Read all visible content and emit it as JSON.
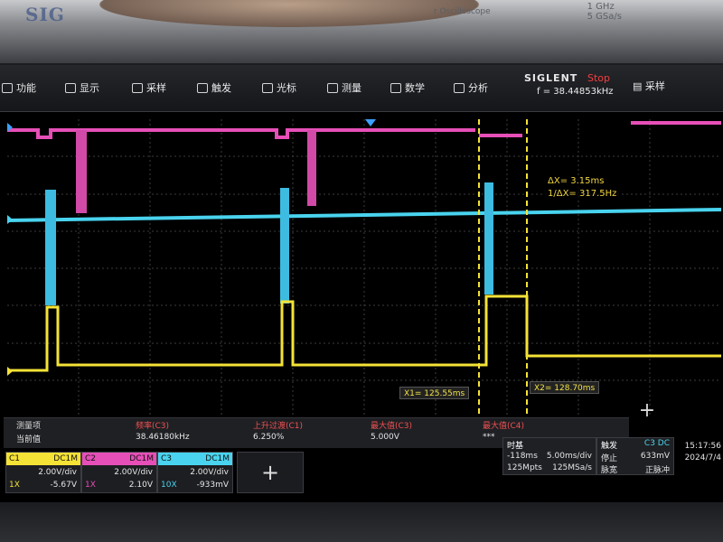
{
  "bezel": {
    "brand": "SIG",
    "model_text": "r Oscilloscope",
    "spec_line1": "1 GHz",
    "spec_line2": "5 GSa/s"
  },
  "menu": {
    "items": [
      {
        "label": "功能",
        "icon": "function-icon"
      },
      {
        "label": "显示",
        "icon": "display-icon"
      },
      {
        "label": "采样",
        "icon": "acquire-icon"
      },
      {
        "label": "触发",
        "icon": "trigger-icon"
      },
      {
        "label": "光标",
        "icon": "cursor-icon"
      },
      {
        "label": "测量",
        "icon": "measure-icon"
      },
      {
        "label": "数学",
        "icon": "math-icon"
      },
      {
        "label": "分析",
        "icon": "analysis-icon"
      }
    ],
    "brand": "SIGLENT",
    "status": "Stop",
    "frequency": "f = 38.44853kHz",
    "sample_label": "采样"
  },
  "cursors": {
    "x1": "X1= 125.55ms",
    "x2": "X2= 128.70ms",
    "delta_x": "ΔX= 3.15ms",
    "inv_delta_x": "1/ΔX= 317.5Hz"
  },
  "measurements": {
    "row_label_header": "测量项",
    "row_label_value": "当前值",
    "columns": [
      {
        "header": "频率(C3)",
        "value": "38.46180kHz"
      },
      {
        "header": "上升过渡(C1)",
        "value": "6.250%"
      },
      {
        "header": "最大值(C3)",
        "value": "5.000V"
      },
      {
        "header": "最大值(C4)",
        "value": "***"
      }
    ]
  },
  "channels": [
    {
      "name": "C1",
      "coupling": "DC1M",
      "scale": "2.00V/div",
      "probe": "1X",
      "offset": "-5.67V",
      "color": "#f5e236"
    },
    {
      "name": "C2",
      "coupling": "DC1M",
      "scale": "2.00V/div",
      "probe": "1X",
      "offset": "2.10V",
      "color": "#e64fb7"
    },
    {
      "name": "C3",
      "coupling": "DC1M",
      "scale": "2.00V/div",
      "probe": "10X",
      "offset": "-933mV",
      "color": "#49d3ee"
    }
  ],
  "timebase": {
    "title": "时基",
    "delay": "-118ms",
    "scale": "5.00ms/div",
    "memory": "125Mpts",
    "rate": "125MSa/s"
  },
  "trigger": {
    "title": "触发",
    "source": "C3 DC",
    "state": "停止",
    "level": "633mV",
    "type": "脉宽",
    "slope": "正脉冲"
  },
  "clock": {
    "time": "15:17:56",
    "date": "2024/7/4"
  },
  "waveform_colors": {
    "c1": "#f5e236",
    "c2": "#e64fb7",
    "c3": "#49d3ee",
    "cursor": "#f5e236",
    "grid": "#4a4a4a"
  }
}
